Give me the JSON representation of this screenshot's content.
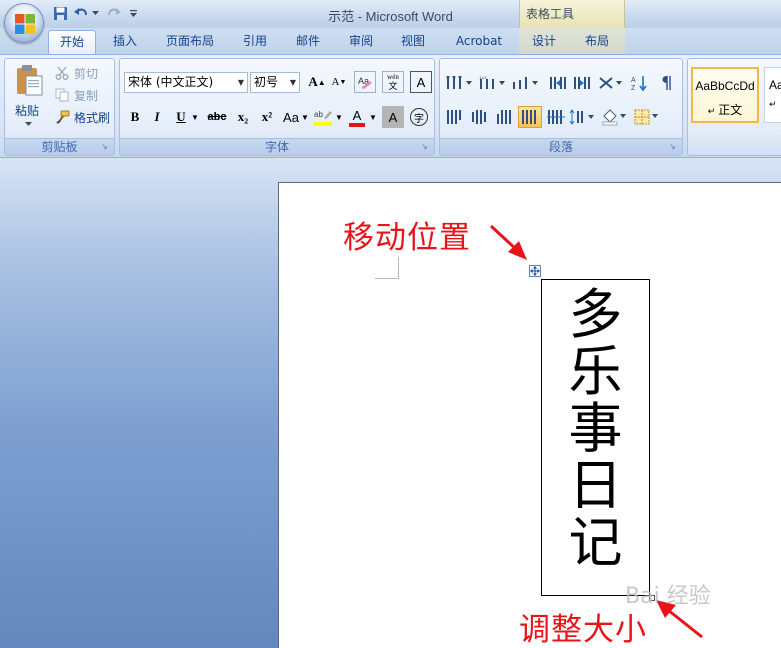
{
  "app": {
    "title": "示范 - Microsoft Word",
    "contextual_group": "表格工具"
  },
  "tabs": [
    {
      "label": "开始",
      "active": true
    },
    {
      "label": "插入"
    },
    {
      "label": "页面布局"
    },
    {
      "label": "引用"
    },
    {
      "label": "邮件"
    },
    {
      "label": "审阅"
    },
    {
      "label": "视图"
    },
    {
      "label": "Acrobat"
    },
    {
      "label": "设计"
    },
    {
      "label": "布局"
    }
  ],
  "clipboard": {
    "paste": "粘贴",
    "cut": "剪切",
    "copy": "复制",
    "format_painter": "格式刷",
    "label": "剪贴板"
  },
  "font": {
    "name": "宋体 (中文正文)",
    "size": "初号",
    "label": "字体",
    "grow": "A",
    "shrink": "A",
    "phonetic": "wén",
    "bold": "B",
    "italic": "I",
    "underline": "U",
    "strike": "abc",
    "subscript": "x₂",
    "superscript": "x²",
    "change_case": "Aa",
    "font_color": "A",
    "char_shading": "A",
    "enclose": "字",
    "highlight_color": "#ffff00",
    "font_color_value": "#e8141a"
  },
  "paragraph": {
    "label": "段落"
  },
  "styles": {
    "normal_preview": "AaBbCcDd",
    "normal_name": "正文",
    "next_preview": "Aa"
  },
  "document": {
    "vertical_text": [
      "多",
      "乐",
      "事",
      "日",
      "记"
    ]
  },
  "annotations": {
    "move": "移动位置",
    "resize": "调整大小",
    "color": "#e8141a"
  },
  "watermark": "Bai 经验"
}
